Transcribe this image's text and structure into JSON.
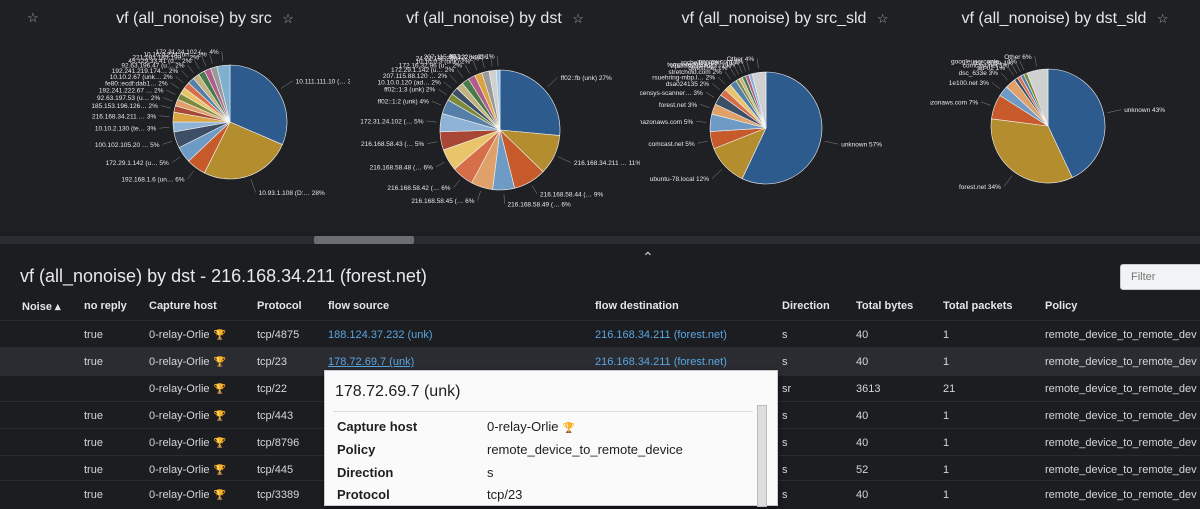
{
  "dashboard": {
    "top_star": "☆",
    "charts": [
      {
        "title": "vf (all_nonoise) by src",
        "star": "☆",
        "slices": [
          {
            "label": "10.111.111.10 (…",
            "pct": 34,
            "color": "#2e5b8e"
          },
          {
            "label": "10.93.1.108 (D:…",
            "pct": 28,
            "color": "#b38d2e"
          },
          {
            "label": "192.168.1.6 (un…",
            "pct": 6,
            "color": "#c65a2a"
          },
          {
            "label": "172.29.1.142 (u…",
            "pct": 5,
            "color": "#6d9bc5"
          },
          {
            "label": "100.102.105.20 …",
            "pct": 5,
            "color": "#3d4f66"
          },
          {
            "label": "10.10.2.130 (te…",
            "pct": 3,
            "color": "#8fb3d6"
          },
          {
            "label": "216.168.34.211 …",
            "pct": 3,
            "color": "#d9a441"
          },
          {
            "label": "185.153.196.126…",
            "pct": 2,
            "color": "#a84733"
          },
          {
            "label": "92.63.197.53 (u…",
            "pct": 2,
            "color": "#e0a06a"
          },
          {
            "label": "192.241.222.67 …",
            "pct": 2,
            "color": "#7e8a3b"
          },
          {
            "label": "fe80::ecdf:dab1…",
            "pct": 2,
            "color": "#e8c46a"
          },
          {
            "label": "10.10.2.67 (unk…",
            "pct": 2,
            "color": "#d66f49"
          },
          {
            "label": "192.241.219.174…",
            "pct": 2,
            "color": "#557fa8"
          },
          {
            "label": "92.63.196.47 (u…",
            "pct": 2,
            "color": "#c2b280"
          },
          {
            "label": "45.129.33.41 (u…",
            "pct": 2,
            "color": "#4a7a4a"
          },
          {
            "label": "221.181.185.199…",
            "pct": 2,
            "color": "#b05d8a"
          },
          {
            "label": "10.10.0.224 (un…",
            "pct": 2,
            "color": "#9a9a9a"
          },
          {
            "label": "172.31.24.102 (…",
            "pct": 4,
            "color": "#7fb0d0"
          }
        ]
      },
      {
        "title": "vf (all_nonoise) by dst",
        "star": "☆",
        "slices": [
          {
            "label": "ff02::fb (unk)",
            "pct": 27,
            "color": "#2e5b8e"
          },
          {
            "label": "216.168.34.211 …",
            "pct": 11,
            "color": "#b38d2e"
          },
          {
            "label": "216.168.58.44 (…",
            "pct": 9,
            "color": "#c65a2a"
          },
          {
            "label": "216.168.58.49 (…",
            "pct": 6,
            "color": "#6d9bc5"
          },
          {
            "label": "216.168.58.45 (…",
            "pct": 6,
            "color": "#e0a06a"
          },
          {
            "label": "216.168.58.42 (…",
            "pct": 6,
            "color": "#d66f49"
          },
          {
            "label": "216.168.58.48 (…",
            "pct": 6,
            "color": "#e8c46a"
          },
          {
            "label": "216.168.58.43 (…",
            "pct": 5,
            "color": "#a84733"
          },
          {
            "label": "172.31.24.102 (…",
            "pct": 5,
            "color": "#8fb3d6"
          },
          {
            "label": "ff02::1:2 (unk)",
            "pct": 4,
            "color": "#557fa8"
          },
          {
            "label": "ff02::1:3 (unk)",
            "pct": 2,
            "color": "#7e8a3b"
          },
          {
            "label": "10.10.0.120 (ad…",
            "pct": 2,
            "color": "#3d4f66"
          },
          {
            "label": "207.115.88.120 …",
            "pct": 2,
            "color": "#c2b280"
          },
          {
            "label": "172.29.1.142 (u…",
            "pct": 2,
            "color": "#4a7a4a"
          },
          {
            "label": "172.16.32.96 (u…",
            "pct": 2,
            "color": "#b05d8a"
          },
          {
            "label": "10.10.0.3 (unk)",
            "pct": 2,
            "color": "#d9a441"
          },
          {
            "label": "24.22.131.248 (…",
            "pct": 2,
            "color": "#9a9a9a"
          },
          {
            "label": "207.115.88.122 …",
            "pct": 2,
            "color": "#d0d0d0"
          },
          {
            "label": "ff02::c (unk)",
            "pct": 1,
            "color": "#a0c4e8"
          }
        ]
      },
      {
        "title": "vf (all_nonoise) by src_sld",
        "star": "☆",
        "slices": [
          {
            "label": "unknown",
            "pct": 57,
            "color": "#2e5b8e"
          },
          {
            "label": "ubuntu-78.local",
            "pct": 12,
            "color": "#b38d2e"
          },
          {
            "label": "comcast.net",
            "pct": 5,
            "color": "#c65a2a"
          },
          {
            "label": "amazonaws.com",
            "pct": 5,
            "color": "#6d9bc5"
          },
          {
            "label": "forest.net",
            "pct": 3,
            "color": "#e0a06a"
          },
          {
            "label": "censys-scanner…",
            "pct": 3,
            "color": "#3d4f66"
          },
          {
            "label": "dsa024135",
            "pct": 2,
            "color": "#d66f49"
          },
          {
            "label": "rsuehring-mbp.l…",
            "pct": 2,
            "color": "#e8c46a"
          },
          {
            "label": "stretchoid.com",
            "pct": 2,
            "color": "#557fa8"
          },
          {
            "label": "qwest.net",
            "pct": 1,
            "color": "#7e8a3b"
          },
          {
            "label": "vipermobile.loc…",
            "pct": 1,
            "color": "#c2b280"
          },
          {
            "label": "temperednetwork…",
            "pct": 1,
            "color": "#4a7a4a"
          },
          {
            "label": "rochelles-ipad…",
            "pct": 1,
            "color": "#b05d8a"
          },
          {
            "label": "myvzw.com",
            "pct": 1,
            "color": "#8fb3d6"
          },
          {
            "label": "Other",
            "pct": 4,
            "color": "#d0d0d0"
          }
        ]
      },
      {
        "title": "vf (all_nonoise) by dst_sld",
        "star": "☆",
        "slices": [
          {
            "label": "unknown",
            "pct": 43,
            "color": "#2e5b8e"
          },
          {
            "label": "forest.net",
            "pct": 34,
            "color": "#b38d2e"
          },
          {
            "label": "amazonaws.com",
            "pct": 7,
            "color": "#c65a2a"
          },
          {
            "label": "1e100.net",
            "pct": 3,
            "color": "#6d9bc5"
          },
          {
            "label": "dsc_633e",
            "pct": 3,
            "color": "#e0a06a"
          },
          {
            "label": "ad-02",
            "pct": 1,
            "color": "#3d4f66"
          },
          {
            "label": "comcast.net",
            "pct": 1,
            "color": "#d66f49"
          },
          {
            "label": "dsc_606e",
            "pct": 1,
            "color": "#557fa8"
          },
          {
            "label": "googleuserconte…",
            "pct": 1,
            "color": "#7e8a3b"
          },
          {
            "label": "Other",
            "pct": 6,
            "color": "#d0d0d0"
          }
        ]
      }
    ]
  },
  "detail": {
    "caret": "⌃",
    "title": "vf (all_nonoise) by dst - 216.168.34.211 (forest.net)",
    "filter_placeholder": "Filter",
    "columns": {
      "noise": "Noise ▴",
      "no_reply": "no reply",
      "capture_host": "Capture host",
      "protocol": "Protocol",
      "flow_source": "flow source",
      "flow_destination": "flow destination",
      "direction": "Direction",
      "total_bytes": "Total bytes",
      "total_packets": "Total packets",
      "policy": "Policy"
    },
    "host_icon": "🏆",
    "rows": [
      {
        "no_reply": "true",
        "capture_host": "0-relay-Orlie",
        "protocol": "tcp/4875",
        "src": "188.124.37.232 (unk)",
        "dst": "216.168.34.211 (forest.net)",
        "direction": "s",
        "bytes": "40",
        "packets": "1",
        "policy": "remote_device_to_remote_dev"
      },
      {
        "no_reply": "true",
        "capture_host": "0-relay-Orlie",
        "protocol": "tcp/23",
        "src": "178.72.69.7 (unk)",
        "dst": "216.168.34.211 (forest.net)",
        "direction": "s",
        "bytes": "40",
        "packets": "1",
        "policy": "remote_device_to_remote_dev"
      },
      {
        "no_reply": "",
        "capture_host": "0-relay-Orlie",
        "protocol": "tcp/22",
        "src": "",
        "dst": "",
        "direction": "sr",
        "bytes": "3613",
        "packets": "21",
        "policy": "remote_device_to_remote_dev"
      },
      {
        "no_reply": "true",
        "capture_host": "0-relay-Orlie",
        "protocol": "tcp/443",
        "src": "",
        "dst": "",
        "direction": "s",
        "bytes": "40",
        "packets": "1",
        "policy": "remote_device_to_remote_dev"
      },
      {
        "no_reply": "true",
        "capture_host": "0-relay-Orlie",
        "protocol": "tcp/8796",
        "src": "",
        "dst": "",
        "direction": "s",
        "bytes": "40",
        "packets": "1",
        "policy": "remote_device_to_remote_dev"
      },
      {
        "no_reply": "true",
        "capture_host": "0-relay-Orlie",
        "protocol": "tcp/445",
        "src": "",
        "dst": "",
        "direction": "s",
        "bytes": "52",
        "packets": "1",
        "policy": "remote_device_to_remote_dev"
      },
      {
        "no_reply": "true",
        "capture_host": "0-relay-Orlie",
        "protocol": "tcp/3389",
        "src": "",
        "dst": "",
        "direction": "s",
        "bytes": "40",
        "packets": "1",
        "policy": "remote_device_to_remote_dev"
      }
    ]
  },
  "tooltip": {
    "title": "178.72.69.7 (unk)",
    "fields": [
      {
        "key": "Capture host",
        "value": "0-relay-Orlie"
      },
      {
        "key": "Policy",
        "value": "remote_device_to_remote_device"
      },
      {
        "key": "Direction",
        "value": "s"
      },
      {
        "key": "Protocol",
        "value": "tcp/23"
      }
    ]
  }
}
